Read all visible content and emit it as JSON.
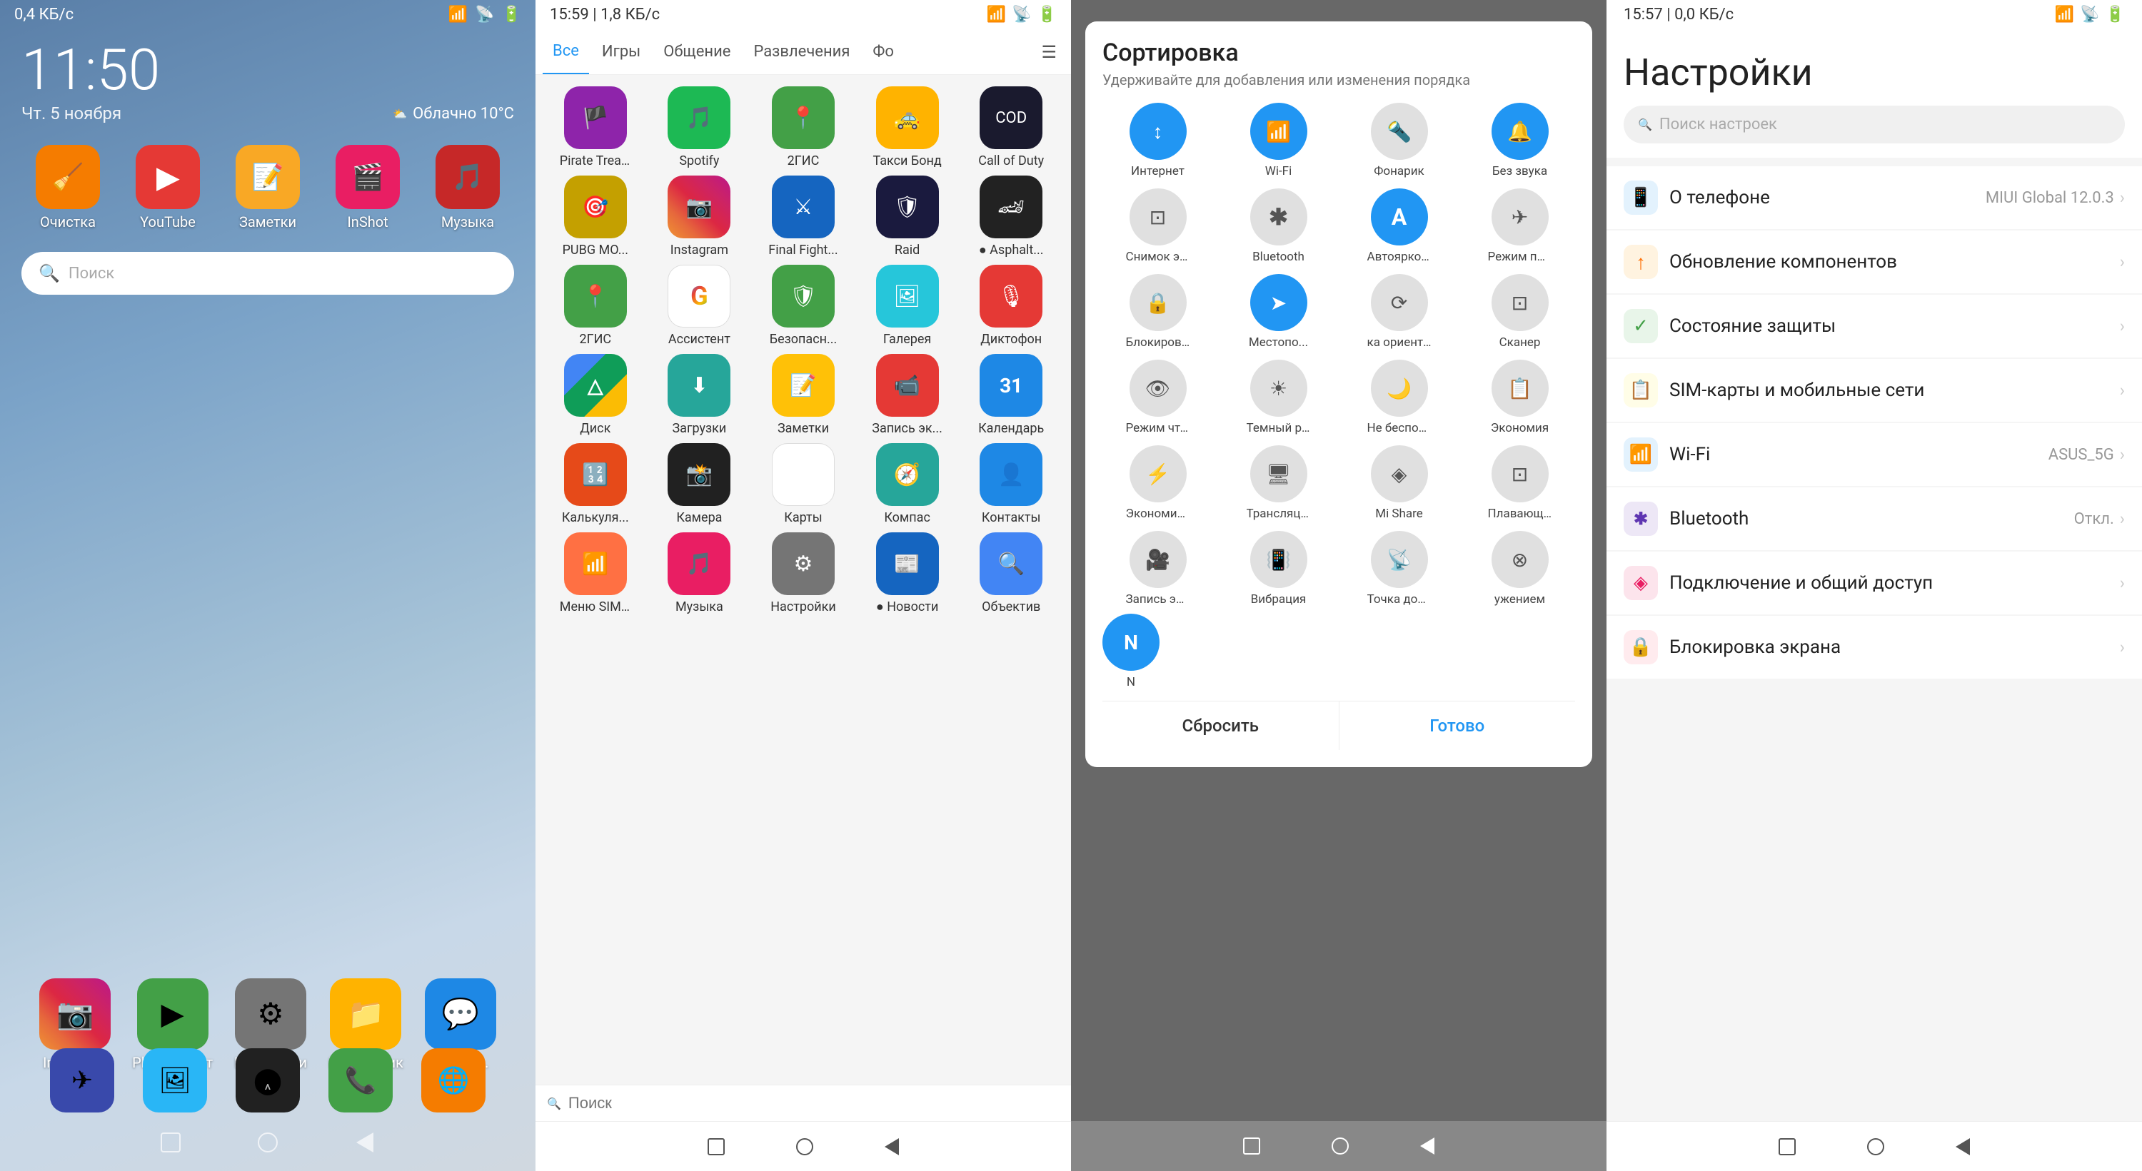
{
  "panel1": {
    "status": {
      "left": "0,4 КБ/с",
      "time": "11:50",
      "right": "Облачно 10°C",
      "date": "Чт. 5 ноября"
    },
    "apps": [
      {
        "label": "Очистка",
        "icon": "🧹",
        "color": "ic-orange"
      },
      {
        "label": "YouTube",
        "icon": "▶",
        "color": "ic-red"
      },
      {
        "label": "Заметки",
        "icon": "📝",
        "color": "ic-yellow"
      },
      {
        "label": "InShot",
        "icon": "🎬",
        "color": "ic-pink"
      },
      {
        "label": "Музыка",
        "icon": "🎵",
        "color": "ic-crimson"
      }
    ],
    "search_placeholder": "Поиск",
    "dock": [
      {
        "label": "Instagram",
        "icon": "📷",
        "color": "ic-instagram"
      },
      {
        "label": "Play Маркет",
        "icon": "▶",
        "color": "ic-green"
      },
      {
        "label": "Настройки",
        "icon": "⚙",
        "color": "ic-grey"
      },
      {
        "label": "Проводник",
        "icon": "📁",
        "color": "ic-amber"
      },
      {
        "label": "Сообщ...",
        "icon": "💬",
        "color": "ic-blue"
      }
    ],
    "bottom_dock": [
      {
        "icon": "✈",
        "color": "ic-indigo"
      },
      {
        "icon": "🖼",
        "color": "ic-lightblue"
      },
      {
        "icon": "⬤",
        "color": "ic-black"
      },
      {
        "icon": "📞",
        "color": "ic-green"
      },
      {
        "icon": "🌐",
        "color": "ic-orange"
      }
    ]
  },
  "panel2": {
    "status_left": "15:59 | 1,8 КБ/с",
    "tabs": [
      "Все",
      "Игры",
      "Общение",
      "Развлечения",
      "Фо"
    ],
    "active_tab": "Все",
    "apps": [
      {
        "label": "Pirate Trea...",
        "color": "ic-purple",
        "icon": "🏴"
      },
      {
        "label": "Spotify",
        "color": "ic-spotify",
        "icon": "🎵"
      },
      {
        "label": "2ГИС",
        "color": "ic-2gis",
        "icon": "📍"
      },
      {
        "label": "Такси Бонд",
        "color": "ic-amber",
        "icon": "🚕"
      },
      {
        "label": "Call of Duty",
        "color": "ic-call",
        "icon": "🎮"
      },
      {
        "label": "PUBG MO...",
        "color": "ic-pubg",
        "icon": "🎯"
      },
      {
        "label": "Instagram",
        "color": "ic-instagram",
        "icon": "📷"
      },
      {
        "label": "Final Fight...",
        "color": "ic-darkblue",
        "icon": "⚔"
      },
      {
        "label": "Raid",
        "color": "ic-raid",
        "icon": "🛡"
      },
      {
        "label": "● Asphalt...",
        "color": "ic-asphalt",
        "icon": "🏎"
      },
      {
        "label": "2ГИС",
        "color": "ic-2gis",
        "icon": "📍"
      },
      {
        "label": "Ассистент",
        "color": "ic-assistant",
        "icon": "🤖"
      },
      {
        "label": "Безопасн...",
        "color": "ic-green",
        "icon": "🛡"
      },
      {
        "label": "Галерея",
        "color": "ic-gallery",
        "icon": "🖼"
      },
      {
        "label": "Диктофон",
        "color": "ic-red",
        "icon": "🎙"
      },
      {
        "label": "Диск",
        "color": "ic-drive",
        "icon": "△"
      },
      {
        "label": "Загрузки",
        "color": "ic-downloads",
        "icon": "⬇"
      },
      {
        "label": "Заметки",
        "color": "ic-notes",
        "icon": "📝"
      },
      {
        "label": "Запись эк...",
        "color": "ic-record",
        "icon": "📹"
      },
      {
        "label": "Календарь",
        "color": "ic-calendar",
        "icon": "📅"
      },
      {
        "label": "Калькуля...",
        "color": "ic-calculator",
        "icon": "🔢"
      },
      {
        "label": "Камера",
        "color": "ic-camera",
        "icon": "📸"
      },
      {
        "label": "Карты",
        "color": "ic-maps",
        "icon": "🗺"
      },
      {
        "label": "Компас",
        "color": "ic-compass",
        "icon": "🧭"
      },
      {
        "label": "Контакты",
        "color": "ic-contacts",
        "icon": "👤"
      },
      {
        "label": "Меню SIM...",
        "color": "ic-menu-sim",
        "icon": "📶"
      },
      {
        "label": "Музыка",
        "color": "ic-music",
        "icon": "🎵"
      },
      {
        "label": "Настройки",
        "color": "ic-settings-grey",
        "icon": "⚙"
      },
      {
        "label": "● Новости",
        "color": "ic-news",
        "icon": "📰"
      },
      {
        "label": "Объектив",
        "color": "ic-lens",
        "icon": "🔍"
      }
    ],
    "search_placeholder": "Поиск"
  },
  "panel3": {
    "title": "Сортировка",
    "subtitle": "Удерживайте для добавления или изменения порядка",
    "items": [
      {
        "label": "Интернет",
        "icon": "↕",
        "active": true
      },
      {
        "label": "Wi-Fi",
        "icon": "📶",
        "active": true
      },
      {
        "label": "Фонарик",
        "icon": "🔦",
        "active": false
      },
      {
        "label": "Без звука",
        "icon": "🔔",
        "active": true
      },
      {
        "label": "Снимок экрана",
        "icon": "⬛",
        "active": false
      },
      {
        "label": "Bluetooth",
        "icon": "✱",
        "active": false
      },
      {
        "label": "Автояркость",
        "icon": "A",
        "active": true
      },
      {
        "label": "Режим полета",
        "icon": "✈",
        "active": false
      },
      {
        "label": "Блокировка",
        "icon": "🔒",
        "active": false
      },
      {
        "label": "Местопо...",
        "icon": "➤",
        "active": true
      },
      {
        "label": "ка ориентации",
        "icon": "⟳",
        "active": false
      },
      {
        "label": "Сканер",
        "icon": "⊡",
        "active": false
      },
      {
        "label": "Режим чтения",
        "icon": "👁",
        "active": false
      },
      {
        "label": "Темный режим",
        "icon": "☀",
        "active": false
      },
      {
        "label": "Не беспокоить",
        "icon": "🌙",
        "active": false
      },
      {
        "label": "Экономия",
        "icon": "📋",
        "active": false
      },
      {
        "label": "Экономия эне...",
        "icon": "⚡",
        "active": false
      },
      {
        "label": "Трансляция",
        "icon": "🖥",
        "active": false
      },
      {
        "label": "Mi Share",
        "icon": "◈",
        "active": false
      },
      {
        "label": "Плавающ...",
        "icon": "⊡",
        "active": false
      },
      {
        "label": "Запись экрана",
        "icon": "🎥",
        "active": false
      },
      {
        "label": "Вибрация",
        "icon": "📳",
        "active": false
      },
      {
        "label": "Точка доступа",
        "icon": "📡",
        "active": false
      },
      {
        "label": "ужением",
        "icon": "⊗",
        "active": false
      },
      {
        "label": "N",
        "icon": "N",
        "active": true
      }
    ],
    "reset_label": "Сбросить",
    "done_label": "Готово"
  },
  "panel4": {
    "status_left": "15:57 | 0,0 КБ/с",
    "title": "Настройки",
    "search_placeholder": "Поиск настроек",
    "items": [
      {
        "label": "О телефоне",
        "value": "MIUI Global 12.0.3",
        "icon": "📱",
        "color": "si-blue"
      },
      {
        "label": "Обновление компонентов",
        "value": "",
        "icon": "↑",
        "color": "si-orange"
      },
      {
        "label": "Состояние защиты",
        "value": "",
        "icon": "✓",
        "color": "si-green"
      },
      {
        "label": "SIM-карты и мобильные сети",
        "value": "",
        "icon": "📋",
        "color": "si-yellow"
      },
      {
        "label": "Wi-Fi",
        "value": "ASUS_5G",
        "icon": "📶",
        "color": "si-wifi"
      },
      {
        "label": "Bluetooth",
        "value": "Откл.",
        "icon": "✱",
        "color": "si-bluetooth"
      },
      {
        "label": "Подключение и общий доступ",
        "value": "",
        "icon": "◈",
        "color": "si-connect"
      },
      {
        "label": "Блокировка экрана",
        "value": "",
        "icon": "🔒",
        "color": "si-lock"
      }
    ]
  }
}
